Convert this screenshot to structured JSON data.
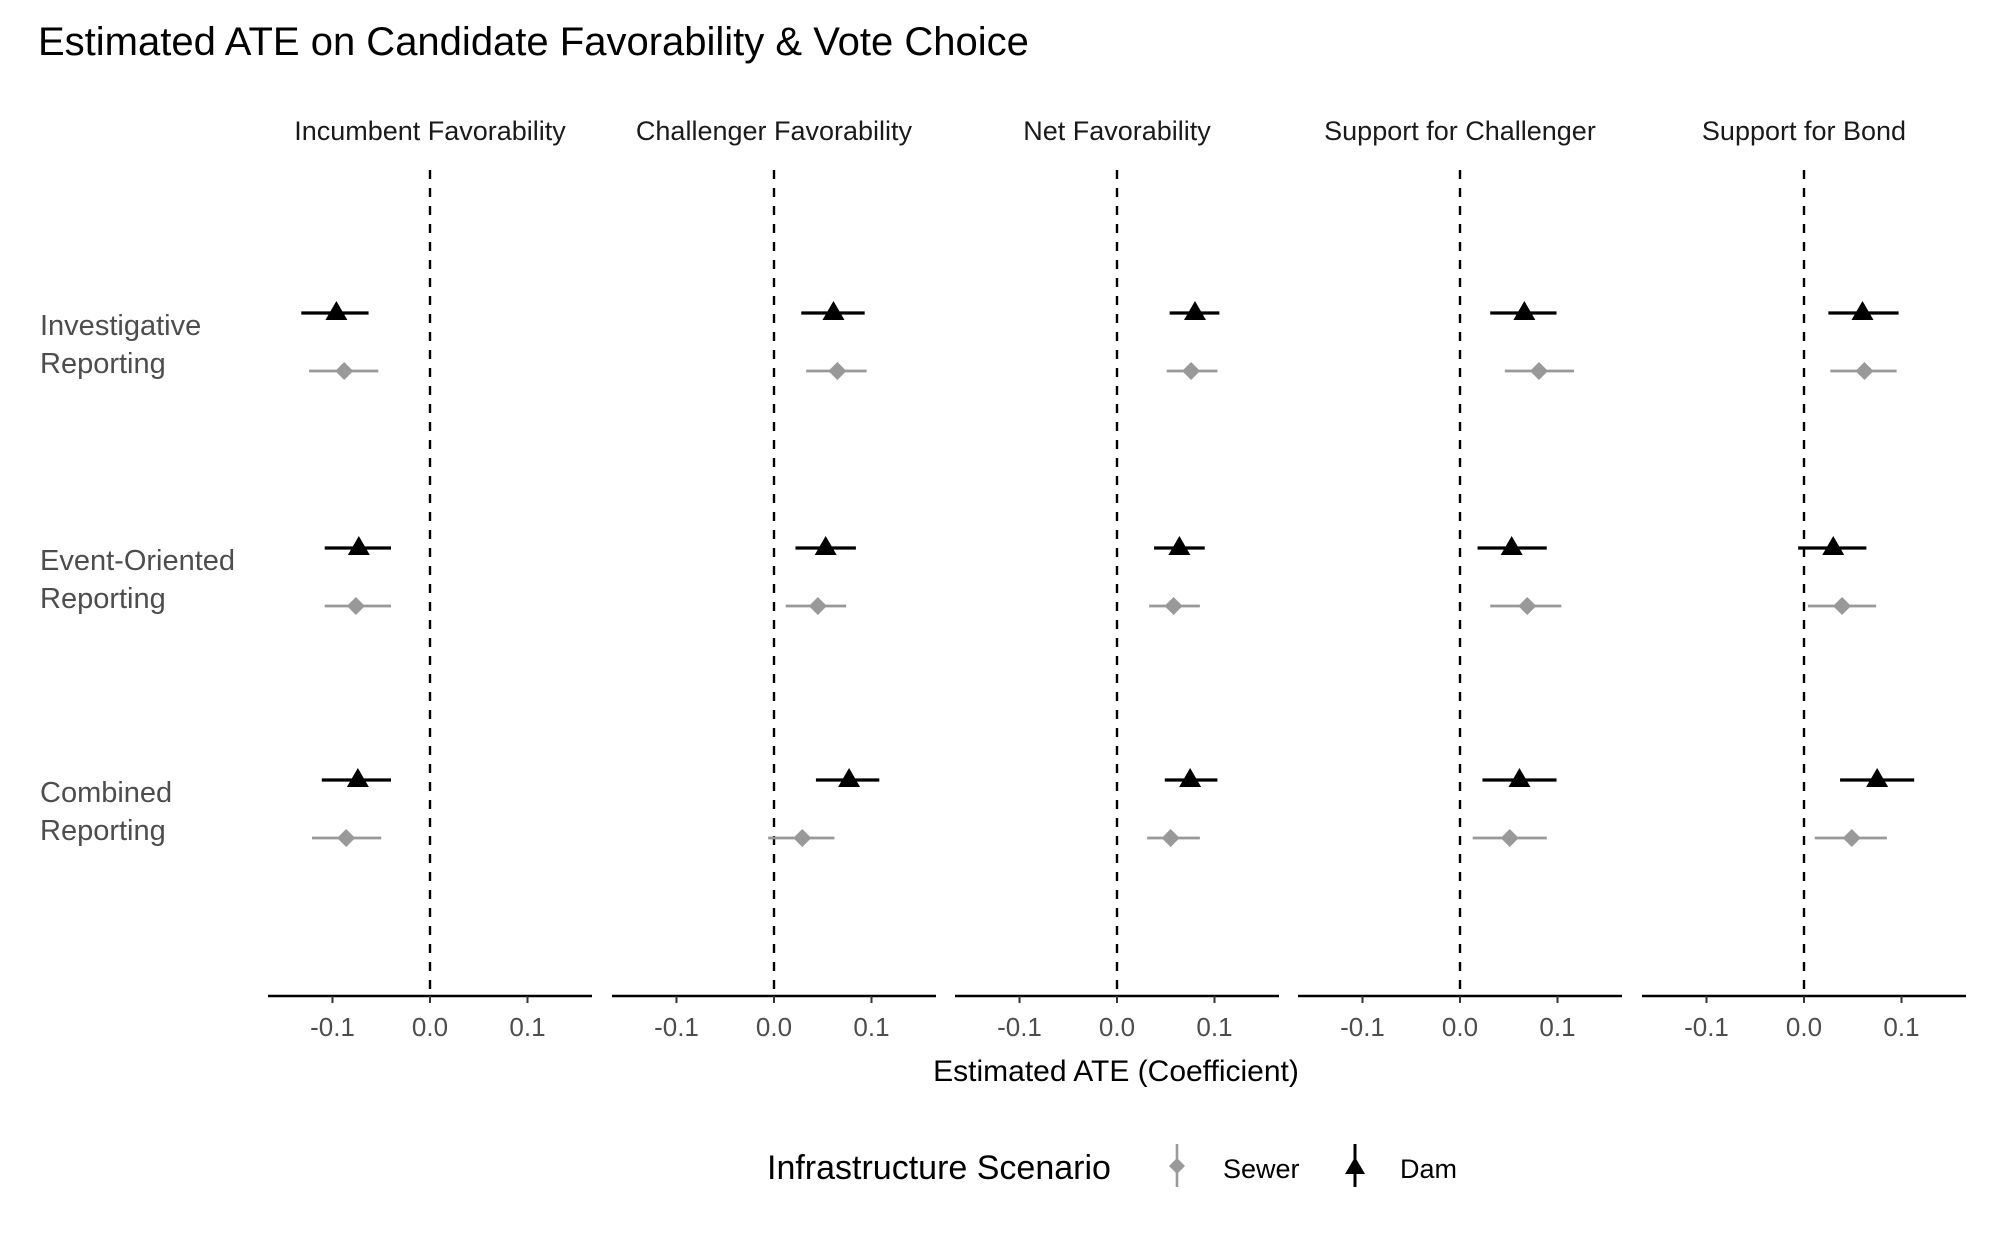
{
  "chart_data": {
    "type": "scatter",
    "subtype": "coefficient-plot-with-confidence-intervals",
    "title": "Estimated ATE on Candidate Favorability & Vote Choice",
    "xlabel": "Estimated ATE (Coefficient)",
    "ylabel": "",
    "xlim": [
      -0.165,
      0.165
    ],
    "xticks": [
      -0.1,
      0.0,
      0.1
    ],
    "xtick_labels": [
      "-0.1",
      "0.0",
      "0.1"
    ],
    "reference_line": {
      "x": 0,
      "style": "dashed"
    },
    "grid": false,
    "categories": [
      "Investigative Reporting",
      "Event-Oriented Reporting",
      "Combined Reporting"
    ],
    "category_display": [
      [
        "Investigative",
        "Reporting"
      ],
      [
        "Event-Oriented",
        "Reporting"
      ],
      [
        "Combined",
        "Reporting"
      ]
    ],
    "panels": [
      {
        "title": "Incumbent Favorability",
        "series": [
          {
            "name": "Dam",
            "estimates": [
              -0.096,
              -0.073,
              -0.074
            ],
            "ci_low": [
              -0.132,
              -0.108,
              -0.111
            ],
            "ci_high": [
              -0.063,
              -0.04,
              -0.04
            ]
          },
          {
            "name": "Sewer",
            "estimates": [
              -0.088,
              -0.076,
              -0.086
            ],
            "ci_low": [
              -0.124,
              -0.108,
              -0.121
            ],
            "ci_high": [
              -0.053,
              -0.04,
              -0.05
            ]
          }
        ]
      },
      {
        "title": "Challenger Favorability",
        "series": [
          {
            "name": "Dam",
            "estimates": [
              0.061,
              0.053,
              0.077
            ],
            "ci_low": [
              0.028,
              0.022,
              0.043
            ],
            "ci_high": [
              0.093,
              0.084,
              0.108
            ]
          },
          {
            "name": "Sewer",
            "estimates": [
              0.065,
              0.045,
              0.029
            ],
            "ci_low": [
              0.033,
              0.012,
              -0.006
            ],
            "ci_high": [
              0.095,
              0.074,
              0.062
            ]
          }
        ]
      },
      {
        "title": "Net Favorability",
        "series": [
          {
            "name": "Dam",
            "estimates": [
              0.08,
              0.064,
              0.075
            ],
            "ci_low": [
              0.054,
              0.038,
              0.049
            ],
            "ci_high": [
              0.105,
              0.09,
              0.103
            ]
          },
          {
            "name": "Sewer",
            "estimates": [
              0.076,
              0.058,
              0.055
            ],
            "ci_low": [
              0.051,
              0.033,
              0.031
            ],
            "ci_high": [
              0.103,
              0.085,
              0.085
            ]
          }
        ]
      },
      {
        "title": "Support for Challenger",
        "series": [
          {
            "name": "Dam",
            "estimates": [
              0.066,
              0.053,
              0.061
            ],
            "ci_low": [
              0.031,
              0.018,
              0.023
            ],
            "ci_high": [
              0.099,
              0.089,
              0.099
            ]
          },
          {
            "name": "Sewer",
            "estimates": [
              0.081,
              0.069,
              0.051
            ],
            "ci_low": [
              0.046,
              0.031,
              0.013
            ],
            "ci_high": [
              0.117,
              0.104,
              0.089
            ]
          }
        ]
      },
      {
        "title": "Support for Bond",
        "series": [
          {
            "name": "Dam",
            "estimates": [
              0.06,
              0.03,
              0.075
            ],
            "ci_low": [
              0.025,
              -0.006,
              0.037
            ],
            "ci_high": [
              0.097,
              0.064,
              0.113
            ]
          },
          {
            "name": "Sewer",
            "estimates": [
              0.062,
              0.039,
              0.049
            ],
            "ci_low": [
              0.027,
              0.004,
              0.011
            ],
            "ci_high": [
              0.095,
              0.074,
              0.085
            ]
          }
        ]
      }
    ],
    "legend": {
      "title": "Infrastructure Scenario",
      "position": "bottom",
      "entries": [
        {
          "name": "Sewer",
          "shape": "diamond",
          "color": "#999999"
        },
        {
          "name": "Dam",
          "shape": "triangle",
          "color": "#000000"
        }
      ]
    }
  }
}
